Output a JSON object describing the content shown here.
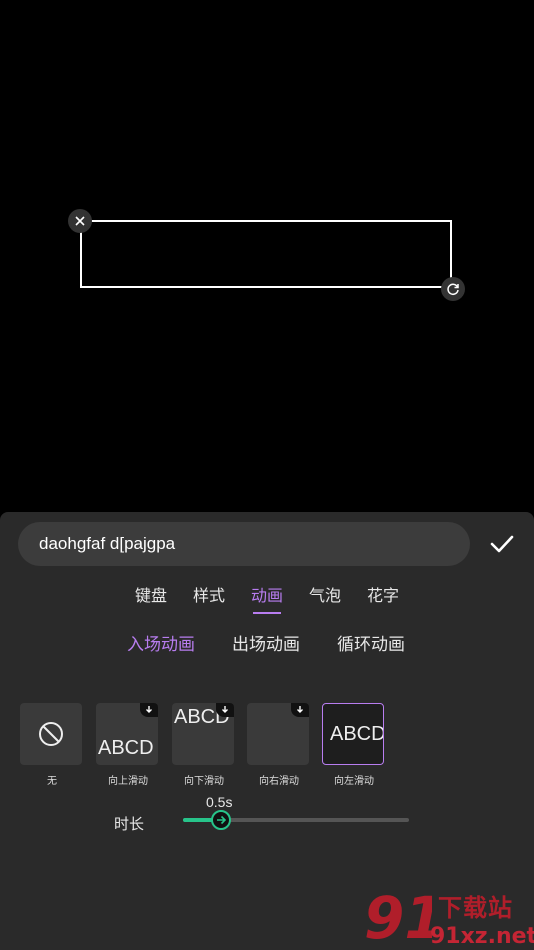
{
  "editor": {
    "text_value": "daohgfaf d[pajgpa"
  },
  "main_tabs": [
    {
      "label": "键盘",
      "active": false
    },
    {
      "label": "样式",
      "active": false
    },
    {
      "label": "动画",
      "active": true
    },
    {
      "label": "气泡",
      "active": false
    },
    {
      "label": "花字",
      "active": false
    }
  ],
  "sub_tabs": [
    {
      "label": "入场动画",
      "active": true
    },
    {
      "label": "出场动画",
      "active": false
    },
    {
      "label": "循环动画",
      "active": false
    }
  ],
  "animations": [
    {
      "label": "无",
      "preview": "",
      "icon": "none-icon"
    },
    {
      "label": "向上滑动",
      "preview": "ABCD",
      "icon": "download-icon"
    },
    {
      "label": "向下滑动",
      "preview": "ABCD",
      "icon": "download-icon"
    },
    {
      "label": "向右滑动",
      "preview": "",
      "icon": "download-icon"
    },
    {
      "label": "向左滑动",
      "preview": "ABCD",
      "selected": true
    }
  ],
  "duration": {
    "label": "时长",
    "value": "0.5s",
    "fraction": 0.17
  },
  "watermark": {
    "logo_text": "91",
    "cn_text": "下载站",
    "url": "91xz.net"
  },
  "colors": {
    "accent": "#b87df0",
    "slider": "#27c48a",
    "watermark": "#c42534"
  }
}
